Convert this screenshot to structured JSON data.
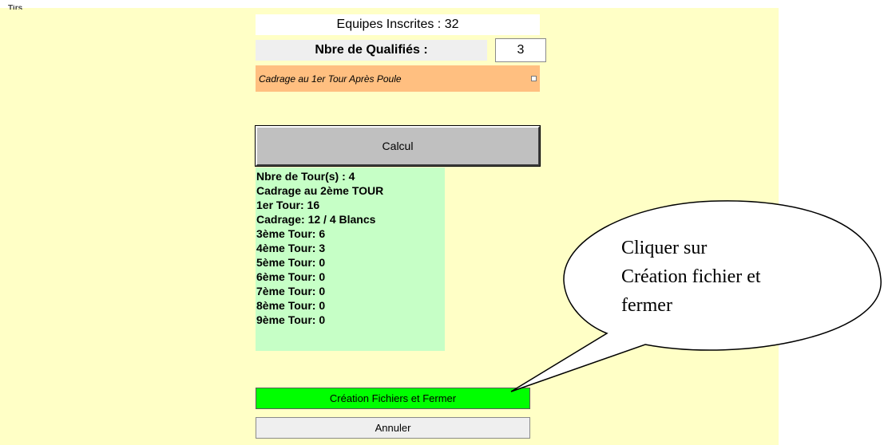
{
  "header": {
    "cut_title": "Tirs"
  },
  "form": {
    "teams_registered": "Equipes Inscrites : 32",
    "qualified_label": "Nbre de Qualifiés :",
    "qualified_value": "3",
    "cadrage_option": "Cadrage au 1er Tour Après Poule",
    "cadrage_checked": false,
    "calcul_label": "Calcul"
  },
  "results": [
    "Nbre de Tour(s) : 4",
    "Cadrage au 2ème TOUR",
    "1er Tour: 16",
    "Cadrage: 12 / 4 Blancs",
    "3ème Tour: 6",
    "4ème Tour: 3",
    "5ème Tour: 0",
    "6ème Tour: 0",
    "7ème Tour: 0",
    "8ème Tour: 0",
    "9ème Tour: 0"
  ],
  "actions": {
    "create_label": "Création Fichiers et Fermer",
    "cancel_label": "Annuler"
  },
  "callout": {
    "lines": [
      "Cliquer sur",
      "Création fichier et",
      "fermer"
    ]
  },
  "colors": {
    "panel_background": "#ffffc6",
    "cadrage_row": "#ffbf80",
    "results_background": "#c6ffc6",
    "create_button": "#00ff00",
    "calcul_button": "#c0c0c0"
  }
}
